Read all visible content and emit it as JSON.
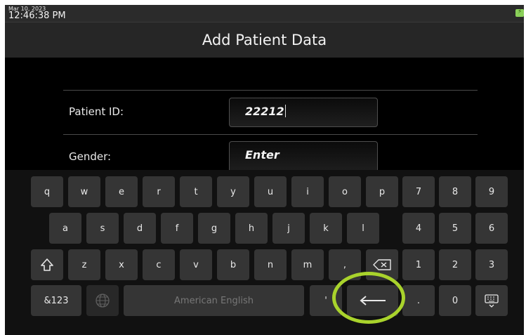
{
  "status": {
    "date": "Mar 10, 2023",
    "time": "12:46:38 PM",
    "battery_color": "#8bd05a"
  },
  "header": {
    "title": "Add Patient Data"
  },
  "form": {
    "patient_id": {
      "label": "Patient ID:",
      "value": "22212"
    },
    "gender": {
      "label": "Gender:",
      "value": "Enter"
    }
  },
  "keyboard": {
    "row1": [
      "q",
      "w",
      "e",
      "r",
      "t",
      "y",
      "u",
      "i",
      "o",
      "p"
    ],
    "row2": [
      "a",
      "s",
      "d",
      "f",
      "g",
      "h",
      "j",
      "k",
      "l"
    ],
    "row3": [
      "z",
      "x",
      "c",
      "v",
      "b",
      "n",
      "m",
      ","
    ],
    "numpad_row1": [
      "7",
      "8",
      "9"
    ],
    "numpad_row2": [
      "4",
      "5",
      "6"
    ],
    "numpad_row3": [
      "1",
      "2",
      "3"
    ],
    "symbols_key": "&123",
    "space_label": "American English",
    "apostrophe": "'",
    "period": ".",
    "zero": "0",
    "icons": {
      "shift": "shift-arrow-icon",
      "backspace": "backspace-icon",
      "enter": "enter-arrow-icon",
      "globe": "globe-icon",
      "hide": "keyboard-hide-icon"
    }
  },
  "annotation": {
    "highlight_color": "#a9d32c"
  }
}
